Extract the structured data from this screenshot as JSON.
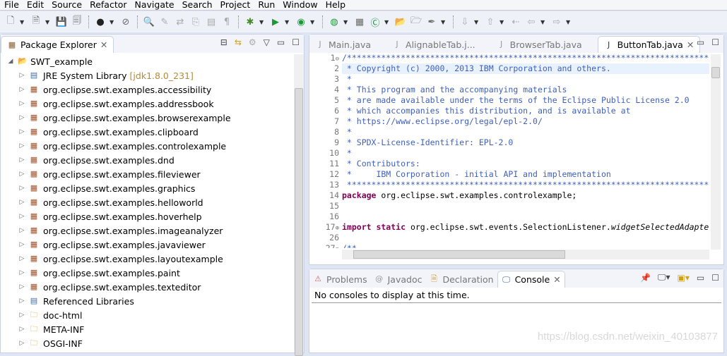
{
  "menu": [
    "File",
    "Edit",
    "Source",
    "Refactor",
    "Navigate",
    "Search",
    "Project",
    "Run",
    "Window",
    "Help"
  ],
  "toolbar_icons": [
    "new-icon",
    "new-class-icon",
    "save-icon",
    "save-all-icon",
    "user-icon",
    "skip-breakpoints-icon",
    "search-icon",
    "edit-icon",
    "toggle-icon",
    "mark-icon",
    "block-icon",
    "pilcrow-icon",
    "debug-icon",
    "run-icon",
    "coverage-icon",
    "external-tools-icon",
    "new-package-icon",
    "new-java-class-icon",
    "open-type-icon",
    "open-task-icon",
    "pen-icon",
    "next-annotation-icon",
    "prev-annotation-icon",
    "last-edit-icon",
    "back-icon",
    "forward-icon"
  ],
  "explorer": {
    "title": "Package Explorer",
    "project": "SWT_example",
    "items": [
      {
        "label": "JRE System Library",
        "extra": "[jdk1.8.0_231]",
        "icon": "library"
      },
      {
        "label": "org.eclipse.swt.examples.accessibility",
        "icon": "package"
      },
      {
        "label": "org.eclipse.swt.examples.addressbook",
        "icon": "package"
      },
      {
        "label": "org.eclipse.swt.examples.browserexample",
        "icon": "package"
      },
      {
        "label": "org.eclipse.swt.examples.clipboard",
        "icon": "package"
      },
      {
        "label": "org.eclipse.swt.examples.controlexample",
        "icon": "package"
      },
      {
        "label": "org.eclipse.swt.examples.dnd",
        "icon": "package"
      },
      {
        "label": "org.eclipse.swt.examples.fileviewer",
        "icon": "package"
      },
      {
        "label": "org.eclipse.swt.examples.graphics",
        "icon": "package"
      },
      {
        "label": "org.eclipse.swt.examples.helloworld",
        "icon": "package"
      },
      {
        "label": "org.eclipse.swt.examples.hoverhelp",
        "icon": "package"
      },
      {
        "label": "org.eclipse.swt.examples.imageanalyzer",
        "icon": "package"
      },
      {
        "label": "org.eclipse.swt.examples.javaviewer",
        "icon": "package"
      },
      {
        "label": "org.eclipse.swt.examples.layoutexample",
        "icon": "package"
      },
      {
        "label": "org.eclipse.swt.examples.paint",
        "icon": "package"
      },
      {
        "label": "org.eclipse.swt.examples.texteditor",
        "icon": "package"
      },
      {
        "label": "Referenced Libraries",
        "icon": "library"
      },
      {
        "label": "doc-html",
        "icon": "folder"
      },
      {
        "label": "META-INF",
        "icon": "folder"
      },
      {
        "label": "OSGI-INF",
        "icon": "folder"
      }
    ]
  },
  "editor": {
    "tabs": [
      "Main.java",
      "AlignableTab.j...",
      "BrowserTab.java",
      "ButtonTab.java"
    ],
    "active": 3,
    "lines": [
      {
        "n": "1",
        "t": "/*******************************************************************************",
        "c": "cm",
        "fold": "⊖"
      },
      {
        "n": "2",
        "t": " * Copyright (c) 2000, 2013 IBM Corporation and others.",
        "c": "cm"
      },
      {
        "n": "3",
        "t": " *",
        "c": "cm"
      },
      {
        "n": "4",
        "t": " * This program and the accompanying materials",
        "c": "cm"
      },
      {
        "n": "5",
        "t": " * are made available under the terms of the Eclipse Public License 2.0",
        "c": "cm"
      },
      {
        "n": "6",
        "t": " * which accompanies this distribution, and is available at",
        "c": "cm"
      },
      {
        "n": "7",
        "t": " * https://www.eclipse.org/legal/epl-2.0/",
        "c": "cm"
      },
      {
        "n": "8",
        "t": " *",
        "c": "cm"
      },
      {
        "n": "9",
        "t": " * SPDX-License-Identifier: EPL-2.0",
        "c": "cm"
      },
      {
        "n": "10",
        "t": " *",
        "c": "cm"
      },
      {
        "n": "11",
        "t": " * Contributors:",
        "c": "cm"
      },
      {
        "n": "12",
        "t": " *     IBM Corporation - initial API and implementation",
        "c": "cm"
      },
      {
        "n": "13",
        "t": " *******************************************************************************/",
        "c": "cm"
      },
      {
        "n": "14",
        "kw": "package",
        "t": " org.eclipse.swt.examples.controlexample;"
      },
      {
        "n": "15",
        "t": ""
      },
      {
        "n": "16",
        "t": ""
      },
      {
        "n": "17",
        "kw": "import static",
        "t": " org.eclipse.swt.events.SelectionListener.",
        "it": "widgetSelectedAdapter;",
        "fold": "⊕"
      },
      {
        "n": "26",
        "t": ""
      },
      {
        "n": "27",
        "t": "/**",
        "c": "cm",
        "fold": "⊖"
      }
    ]
  },
  "bottom": {
    "tabs": [
      "Problems",
      "Javadoc",
      "Declaration",
      "Console"
    ],
    "active": 3,
    "message": "No consoles to display at this time."
  },
  "watermark": "https://blog.csdn.net/weixin_40103877"
}
